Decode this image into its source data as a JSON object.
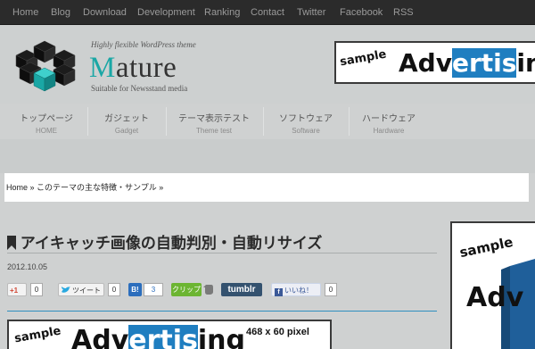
{
  "topnav": {
    "items": [
      "Home",
      "Blog",
      "Download",
      "Development",
      "Ranking",
      "Contact",
      "Twitter",
      "Facebook",
      "RSS"
    ]
  },
  "header": {
    "tagline": "Highly flexible WordPress theme",
    "logo_first": "M",
    "logo_rest": "ature",
    "sublabel": "Suitable for Newsstand media"
  },
  "ad_top": {
    "sample": "sample",
    "pre": "Adv",
    "hl": "ertis",
    "post": "ing"
  },
  "nav": {
    "items": [
      {
        "jp": "トップページ",
        "en": "HOME"
      },
      {
        "jp": "ガジェット",
        "en": "Gadget"
      },
      {
        "jp": "テーマ表示テスト",
        "en": "Theme test"
      },
      {
        "jp": "ソフトウェア",
        "en": "Software"
      },
      {
        "jp": "ハードウェア",
        "en": "Hardware"
      }
    ]
  },
  "breadcrumb": "Home » このテーマの主な特徴・サンプル »",
  "post": {
    "title": "アイキャッチ画像の自動判別・自動リサイズ",
    "date": "2012.10.05"
  },
  "social": {
    "gplus_label": "+1",
    "gplus_count": "0",
    "tweet_label": "ツイート",
    "tweet_count": "0",
    "hatena_label": "B!",
    "hatena_count": "3",
    "clip_label": "クリップ",
    "tumblr_label": "tumblr",
    "fb_label": "いいね！",
    "fb_count": "0"
  },
  "ad_bottom": {
    "sample": "sample",
    "pre": "Adv",
    "hl": "ertis",
    "post": "ing",
    "size": "468 x 60 pixel"
  },
  "ad_side": {
    "sample": "sample",
    "pre": "Adv"
  },
  "colors": {
    "accent": "#1aa7a5",
    "ad_highlight": "#1f7ec0",
    "divider": "#2f8fbf"
  }
}
